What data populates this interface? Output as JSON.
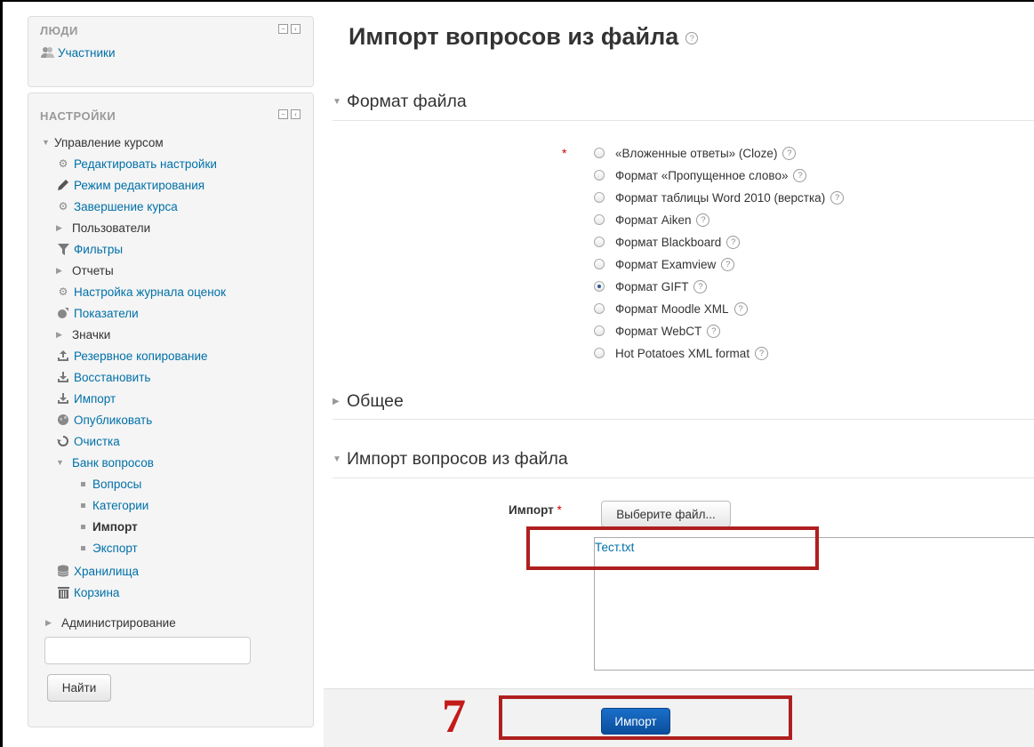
{
  "people_block": {
    "title": "ЛЮДИ",
    "participants": "Участники"
  },
  "settings_block": {
    "title": "НАСТРОЙКИ",
    "course_admin": "Управление курсом",
    "items": {
      "edit_settings": "Редактировать настройки",
      "edit_mode": "Режим редактирования",
      "course_completion": "Завершение курса",
      "users": "Пользователи",
      "filters": "Фильтры",
      "reports": "Отчеты",
      "gradebook_setup": "Настройка журнала оценок",
      "outcomes": "Показатели",
      "badges": "Значки",
      "backup": "Резервное копирование",
      "restore": "Восстановить",
      "import": "Импорт",
      "publish": "Опубликовать",
      "reset": "Очистка",
      "question_bank": "Банк вопросов",
      "questions": "Вопросы",
      "categories": "Категории",
      "qb_import": "Импорт",
      "export": "Экспорт",
      "repositories": "Хранилища",
      "recycle_bin": "Корзина"
    },
    "administration": "Администрирование",
    "search_button": "Найти"
  },
  "main": {
    "title": "Импорт вопросов из файла",
    "format_section": "Формат файла",
    "formats": [
      "«Вложенные ответы» (Cloze)",
      "Формат «Пропущенное слово»",
      "Формат таблицы Word 2010 (верстка)",
      "Формат Aiken",
      "Формат Blackboard",
      "Формат Examview",
      "Формат GIFT",
      "Формат Moodle XML",
      "Формат WebCT",
      "Hot Potatoes XML format"
    ],
    "selected_format": "Формат GIFT",
    "general_section": "Общее",
    "import_section": "Импорт вопросов из файла",
    "import_label": "Импорт",
    "required_mark": "*",
    "choose_file_button": "Выберите файл...",
    "file_name": "Тест.txt",
    "submit_button": "Импорт"
  },
  "annotation": {
    "step_number": "7",
    "color": "#b01f1f"
  },
  "colors": {
    "link": "#0070a8",
    "primary_button": "#0a4e9c",
    "required": "#cc0000"
  }
}
